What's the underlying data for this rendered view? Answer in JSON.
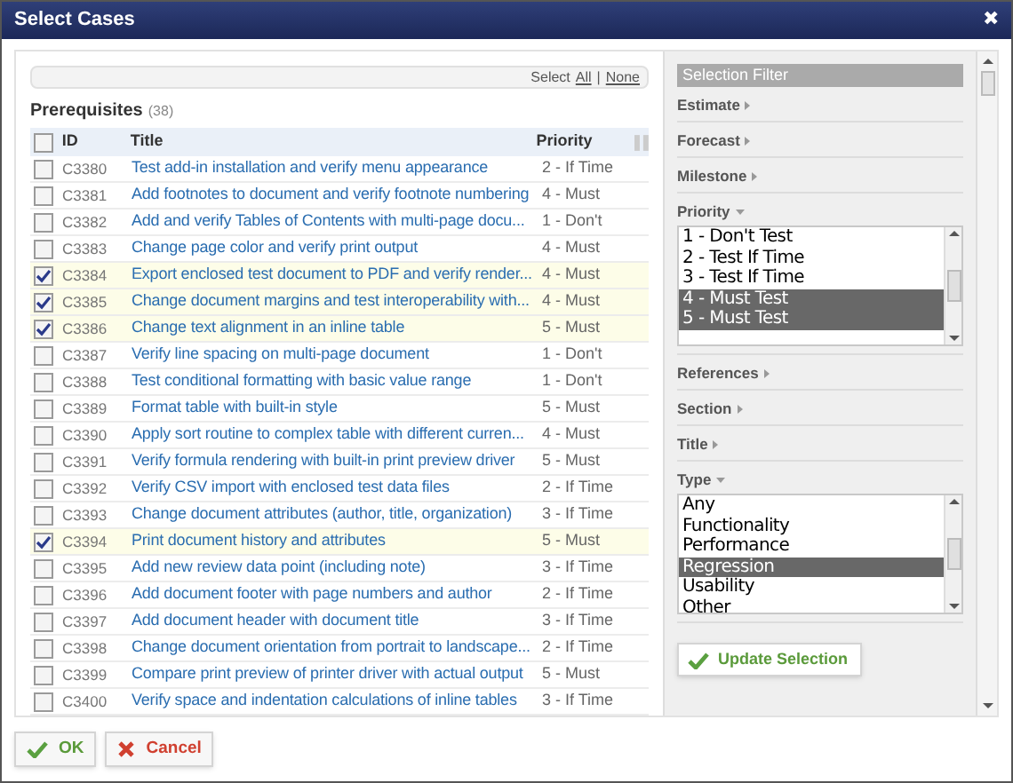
{
  "window": {
    "title": "Select Cases",
    "close": "✖"
  },
  "selection_bar": {
    "prefix": "Select",
    "all": "All",
    "separator": "|",
    "none": "None"
  },
  "list": {
    "title": "Prerequisites",
    "count": "(38)",
    "columns": [
      "ID",
      "Title",
      "Priority"
    ],
    "all_checked": false,
    "rows": [
      {
        "id": "C3380",
        "title": "Test add-in installation and verify menu appearance",
        "priority": "2 - If Time",
        "checked": false
      },
      {
        "id": "C3381",
        "title": "Add footnotes to document and verify footnote numbering",
        "priority": "4 - Must",
        "checked": false
      },
      {
        "id": "C3382",
        "title": "Add and verify Tables of Contents with multi-page docu...",
        "priority": "1 - Don't",
        "checked": false
      },
      {
        "id": "C3383",
        "title": "Change page color and verify print output",
        "priority": "4 - Must",
        "checked": false
      },
      {
        "id": "C3384",
        "title": "Export enclosed test document to PDF and verify render...",
        "priority": "4 - Must",
        "checked": true
      },
      {
        "id": "C3385",
        "title": "Change document margins and test interoperability with...",
        "priority": "4 - Must",
        "checked": true
      },
      {
        "id": "C3386",
        "title": "Change text alignment in an inline table",
        "priority": "5 - Must",
        "checked": true
      },
      {
        "id": "C3387",
        "title": "Verify line spacing on multi-page document",
        "priority": "1 - Don't",
        "checked": false
      },
      {
        "id": "C3388",
        "title": "Test conditional formatting with basic value range",
        "priority": "1 - Don't",
        "checked": false
      },
      {
        "id": "C3389",
        "title": "Format table with built-in style",
        "priority": "5 - Must",
        "checked": false
      },
      {
        "id": "C3390",
        "title": "Apply sort routine to complex table with different curren...",
        "priority": "4 - Must",
        "checked": false
      },
      {
        "id": "C3391",
        "title": "Verify formula rendering with built-in print preview driver",
        "priority": "5 - Must",
        "checked": false
      },
      {
        "id": "C3392",
        "title": "Verify CSV import with enclosed test data files",
        "priority": "2 - If Time",
        "checked": false
      },
      {
        "id": "C3393",
        "title": "Change document attributes (author, title, organization)",
        "priority": "3 - If Time",
        "checked": false
      },
      {
        "id": "C3394",
        "title": "Print document history and attributes",
        "priority": "5 - Must",
        "checked": true
      },
      {
        "id": "C3395",
        "title": "Add new review data point (including note)",
        "priority": "3 - If Time",
        "checked": false
      },
      {
        "id": "C3396",
        "title": "Add document footer with page numbers and author",
        "priority": "2 - If Time",
        "checked": false
      },
      {
        "id": "C3397",
        "title": "Add document header with document title",
        "priority": "3 - If Time",
        "checked": false
      },
      {
        "id": "C3398",
        "title": "Change document orientation from portrait to landscape...",
        "priority": "2 - If Time",
        "checked": false
      },
      {
        "id": "C3399",
        "title": "Compare print preview of printer driver with actual output",
        "priority": "5 - Must",
        "checked": false
      },
      {
        "id": "C3400",
        "title": "Verify space and indentation calculations of inline tables",
        "priority": "3 - If Time",
        "checked": false
      }
    ]
  },
  "filter": {
    "title": "Selection Filter",
    "update_button": "Update Selection",
    "sections": [
      {
        "label": "Estimate",
        "expanded": false
      },
      {
        "label": "Forecast",
        "expanded": false
      },
      {
        "label": "Milestone",
        "expanded": false
      },
      {
        "label": "Priority",
        "expanded": true,
        "options": [
          {
            "label": "1 - Don't Test",
            "selected": false
          },
          {
            "label": "2 - Test If Time",
            "selected": false
          },
          {
            "label": "3 - Test If Time",
            "selected": false
          },
          {
            "label": "4 - Must Test",
            "selected": true
          },
          {
            "label": "5 - Must Test",
            "selected": true
          }
        ]
      },
      {
        "label": "References",
        "expanded": false
      },
      {
        "label": "Section",
        "expanded": false
      },
      {
        "label": "Title",
        "expanded": false
      },
      {
        "label": "Type",
        "expanded": true,
        "options": [
          {
            "label": "Any",
            "selected": false
          },
          {
            "label": "Functionality",
            "selected": false
          },
          {
            "label": "Performance",
            "selected": false
          },
          {
            "label": "Regression",
            "selected": true
          },
          {
            "label": "Usability",
            "selected": false
          },
          {
            "label": "Other",
            "selected": false
          }
        ]
      }
    ]
  },
  "buttons": [
    {
      "label": "OK",
      "kind": "ok"
    },
    {
      "label": "Cancel",
      "kind": "cancel"
    }
  ]
}
